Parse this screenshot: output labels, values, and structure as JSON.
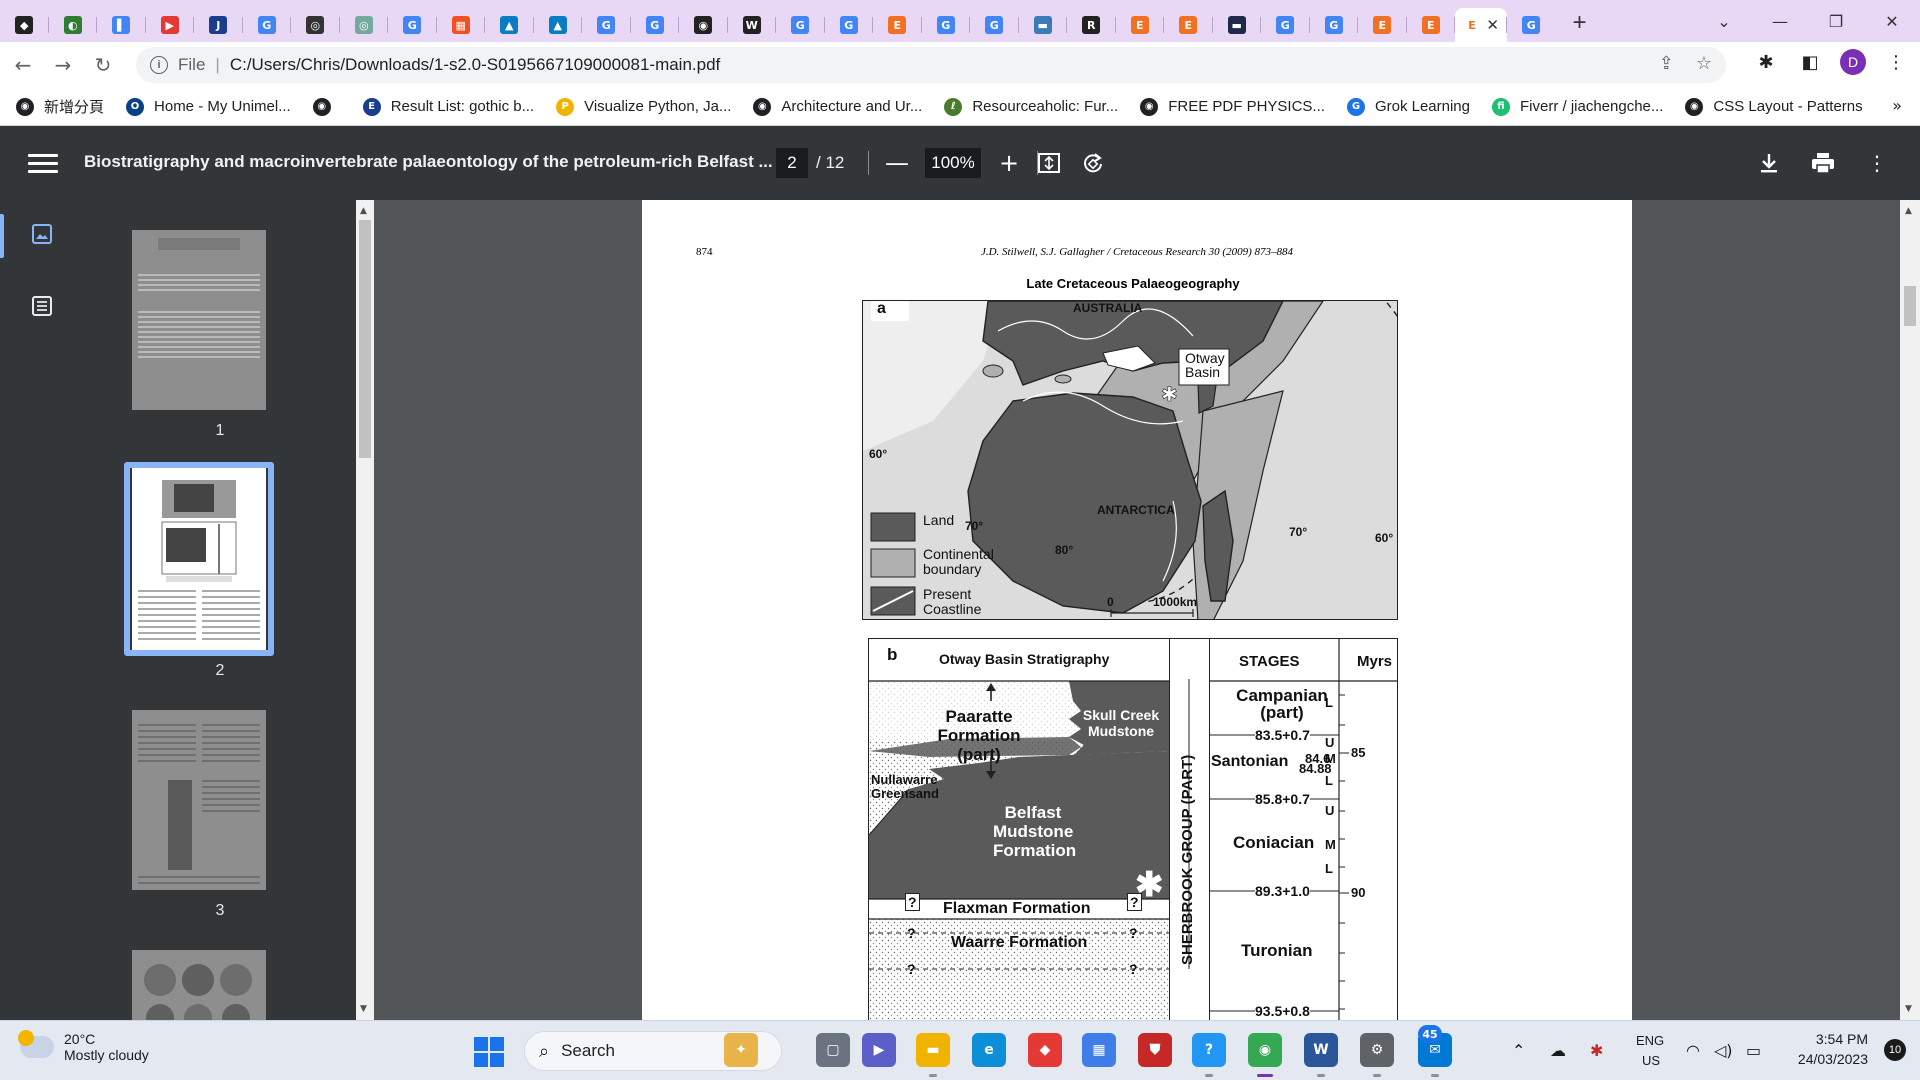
{
  "browser": {
    "tabs": [
      {
        "icon": "dark-diamond-icon",
        "color": "#222222",
        "glyph": "◆"
      },
      {
        "icon": "globe-icon",
        "color": "#2e7d32",
        "glyph": "◐"
      },
      {
        "icon": "bookmark-icon",
        "color": "#4285f4",
        "glyph": "▌"
      },
      {
        "icon": "youtube-icon",
        "color": "#e53935",
        "glyph": "▶"
      },
      {
        "icon": "journal-icon",
        "color": "#1a3d8f",
        "glyph": "J"
      },
      {
        "icon": "google-icon",
        "color": "#4285f4",
        "glyph": "G"
      },
      {
        "icon": "openai-icon",
        "color": "#333333",
        "glyph": "◎"
      },
      {
        "icon": "chatgpt-icon",
        "color": "#74aa9c",
        "glyph": "◎"
      },
      {
        "icon": "google-icon",
        "color": "#4285f4",
        "glyph": "G"
      },
      {
        "icon": "microsoft-icon",
        "color": "#f25022",
        "glyph": "▦"
      },
      {
        "icon": "arrow-app-icon",
        "color": "#0a7cc2",
        "glyph": "▲"
      },
      {
        "icon": "arrow-app-icon",
        "color": "#0a7cc2",
        "glyph": "▲"
      },
      {
        "icon": "google-icon",
        "color": "#4285f4",
        "glyph": "G"
      },
      {
        "icon": "google-icon",
        "color": "#4285f4",
        "glyph": "G"
      },
      {
        "icon": "globe-icon",
        "color": "#222222",
        "glyph": "◉"
      },
      {
        "icon": "wikipedia-icon",
        "color": "#222222",
        "glyph": "W"
      },
      {
        "icon": "google-icon",
        "color": "#4285f4",
        "glyph": "G"
      },
      {
        "icon": "google-icon",
        "color": "#4285f4",
        "glyph": "G"
      },
      {
        "icon": "elsevier-icon",
        "color": "#f27024",
        "glyph": "E"
      },
      {
        "icon": "google-icon",
        "color": "#4285f4",
        "glyph": "G"
      },
      {
        "icon": "google-icon",
        "color": "#4285f4",
        "glyph": "G"
      },
      {
        "icon": "image-app-icon",
        "color": "#3d7ab8",
        "glyph": "▬"
      },
      {
        "icon": "researchgate-icon",
        "color": "#222222",
        "glyph": "R"
      },
      {
        "icon": "elsevier-icon",
        "color": "#f27024",
        "glyph": "E"
      },
      {
        "icon": "elsevier-icon",
        "color": "#f27024",
        "glyph": "E"
      },
      {
        "icon": "image-app-icon",
        "color": "#1f2a4a",
        "glyph": "▬"
      },
      {
        "icon": "google-icon",
        "color": "#4285f4",
        "glyph": "G"
      },
      {
        "icon": "google-icon",
        "color": "#4285f4",
        "glyph": "G"
      },
      {
        "icon": "elsevier-icon",
        "color": "#f27024",
        "glyph": "E"
      },
      {
        "icon": "elsevier-icon",
        "color": "#f27024",
        "glyph": "E"
      }
    ],
    "active_tab": {
      "icon": "elsevier-icon",
      "glyph": "E",
      "close": "✕"
    },
    "after_active_tab": {
      "icon": "google-icon",
      "color": "#4285f4",
      "glyph": "G"
    },
    "new_tab": "+",
    "window_controls": {
      "dropdown": "⌄",
      "minimize": "—",
      "restore": "❐",
      "close": "✕"
    },
    "address": {
      "scheme_label": "File",
      "url": "C:/Users/Chris/Downloads/1-s2.0-S0195667109000081-main.pdf"
    },
    "profile_initial": "D",
    "bookmarks": [
      {
        "label": "新增分頁",
        "color": "#202124",
        "glyph": "◉"
      },
      {
        "label": "Home - My Unimel...",
        "color": "#094183",
        "glyph": "O"
      },
      {
        "label": "",
        "color": "#202124",
        "glyph": "◉"
      },
      {
        "label": "Result List: gothic b...",
        "color": "#1a3d8f",
        "glyph": "E"
      },
      {
        "label": "Visualize Python, Ja...",
        "color": "#f0b400",
        "glyph": "P"
      },
      {
        "label": "Architecture and Ur...",
        "color": "#202124",
        "glyph": "◉"
      },
      {
        "label": "Resourceaholic: Fur...",
        "color": "#4a7b2a",
        "glyph": "ℓ"
      },
      {
        "label": "FREE PDF PHYSICS...",
        "color": "#202124",
        "glyph": "◉"
      },
      {
        "label": "Grok Learning",
        "color": "#1a73e8",
        "glyph": "G"
      },
      {
        "label": "Fiverr / jiachengche...",
        "color": "#1dbf73",
        "glyph": "fi"
      },
      {
        "label": "CSS Layout - Patterns",
        "color": "#202124",
        "glyph": "◉"
      }
    ],
    "bookmarks_more": "»"
  },
  "pdf_viewer": {
    "title": "Biostratigraphy and macroinvertebrate palaeontology of the petroleum-rich Belfast ...",
    "current_page": "2",
    "total_pages": "/ 12",
    "zoom": "100%",
    "zoom_out": "—",
    "zoom_in": "+",
    "thumbnail_numbers": [
      "1",
      "2",
      "3"
    ]
  },
  "document": {
    "page_number": "874",
    "running_header": "J.D. Stilwell, S.J. Gallagher / Cretaceous Research 30 (2009) 873–884",
    "figure_title": "Late Cretaceous Palaeogeography",
    "map": {
      "panel": "a",
      "labels": {
        "australia": "AUSTRALIA",
        "antarctica": "ANTARCTICA",
        "otway_line1": "Otway",
        "otway_line2": "Basin",
        "lat60_left": "60°",
        "lat60_right": "60°",
        "lat70_left": "70°",
        "lat70_right": "70°",
        "lat80": "80°",
        "scale_zero": "0",
        "scale_len": "1000km"
      },
      "legend": [
        {
          "line1": "Land",
          "line2": ""
        },
        {
          "line1": "Continental",
          "line2": "boundary"
        },
        {
          "line1": "Present",
          "line2": "Coastline"
        }
      ],
      "colors": {
        "land": "#5a5a5a",
        "boundary": "#b0b0b0",
        "sea": "#dcdcdc"
      }
    },
    "stratigraphy": {
      "panel": "b",
      "heading": "Otway Basin Stratigraphy",
      "stages_heading": "STAGES",
      "myrs_heading": "Myrs",
      "group_label": "SHERBROOK GROUP (PART)",
      "units": {
        "paaratte_1": "Paaratte",
        "paaratte_2": "Formation (part)",
        "skull_1": "Skull Creek",
        "skull_2": "Mudstone",
        "nullawarre_1": "Nullawarre",
        "nullawarre_2": "Greensand",
        "belfast_1": "Belfast",
        "belfast_2": "Mudstone",
        "belfast_3": "Formation",
        "flaxman": "Flaxman Formation",
        "waarre": "Waarre Formation",
        "question": "?",
        "star": "✱"
      },
      "stages": {
        "campanian_1": "Campanian",
        "campanian_2": "(part)",
        "age_835": "83.5+0.7",
        "santonian": "Santonian",
        "age_846": "84.6",
        "age_8488": "84.88",
        "age_858": "85.8+0.7",
        "coniacian": "Coniacian",
        "age_893": "89.3+1.0",
        "turonian": "Turonian",
        "age_935": "93.5+0.8",
        "sub_L": "L",
        "sub_U": "U",
        "sub_M": "M"
      },
      "myrs_ticks": {
        "t85": "85",
        "t90": "90"
      }
    }
  },
  "taskbar": {
    "temp": "20°C",
    "weather": "Mostly cloudy",
    "search_label": "Search",
    "apps": [
      {
        "name": "widgets-app",
        "color": "#e8b44a",
        "glyph": "✦"
      },
      {
        "name": "task-view-app",
        "color": "#6b7280",
        "glyph": "▢"
      },
      {
        "name": "teams-app",
        "color": "#5b5fc7",
        "glyph": "▶"
      },
      {
        "name": "file-explorer-app",
        "color": "#f0b400",
        "glyph": "▬"
      },
      {
        "name": "edge-app",
        "color": "#0c8ed9",
        "glyph": "e"
      },
      {
        "name": "red-app",
        "color": "#e53935",
        "glyph": "◆"
      },
      {
        "name": "store-app",
        "color": "#3f7ee8",
        "glyph": "▦"
      },
      {
        "name": "shield-app",
        "color": "#c62828",
        "glyph": "⛊"
      },
      {
        "name": "help-app",
        "color": "#2196f3",
        "glyph": "?"
      },
      {
        "name": "chrome-app",
        "color": "#34a853",
        "glyph": "◉"
      },
      {
        "name": "word-app",
        "color": "#2b579a",
        "glyph": "W"
      },
      {
        "name": "settings-app",
        "color": "#5f6368",
        "glyph": "⚙"
      },
      {
        "name": "mail-app",
        "color": "#0078d4",
        "glyph": "✉"
      }
    ],
    "mail_badge": "45",
    "lang_1": "ENG",
    "lang_2": "US",
    "time": "3:54 PM",
    "date": "24/03/2023",
    "notifications": "10"
  }
}
